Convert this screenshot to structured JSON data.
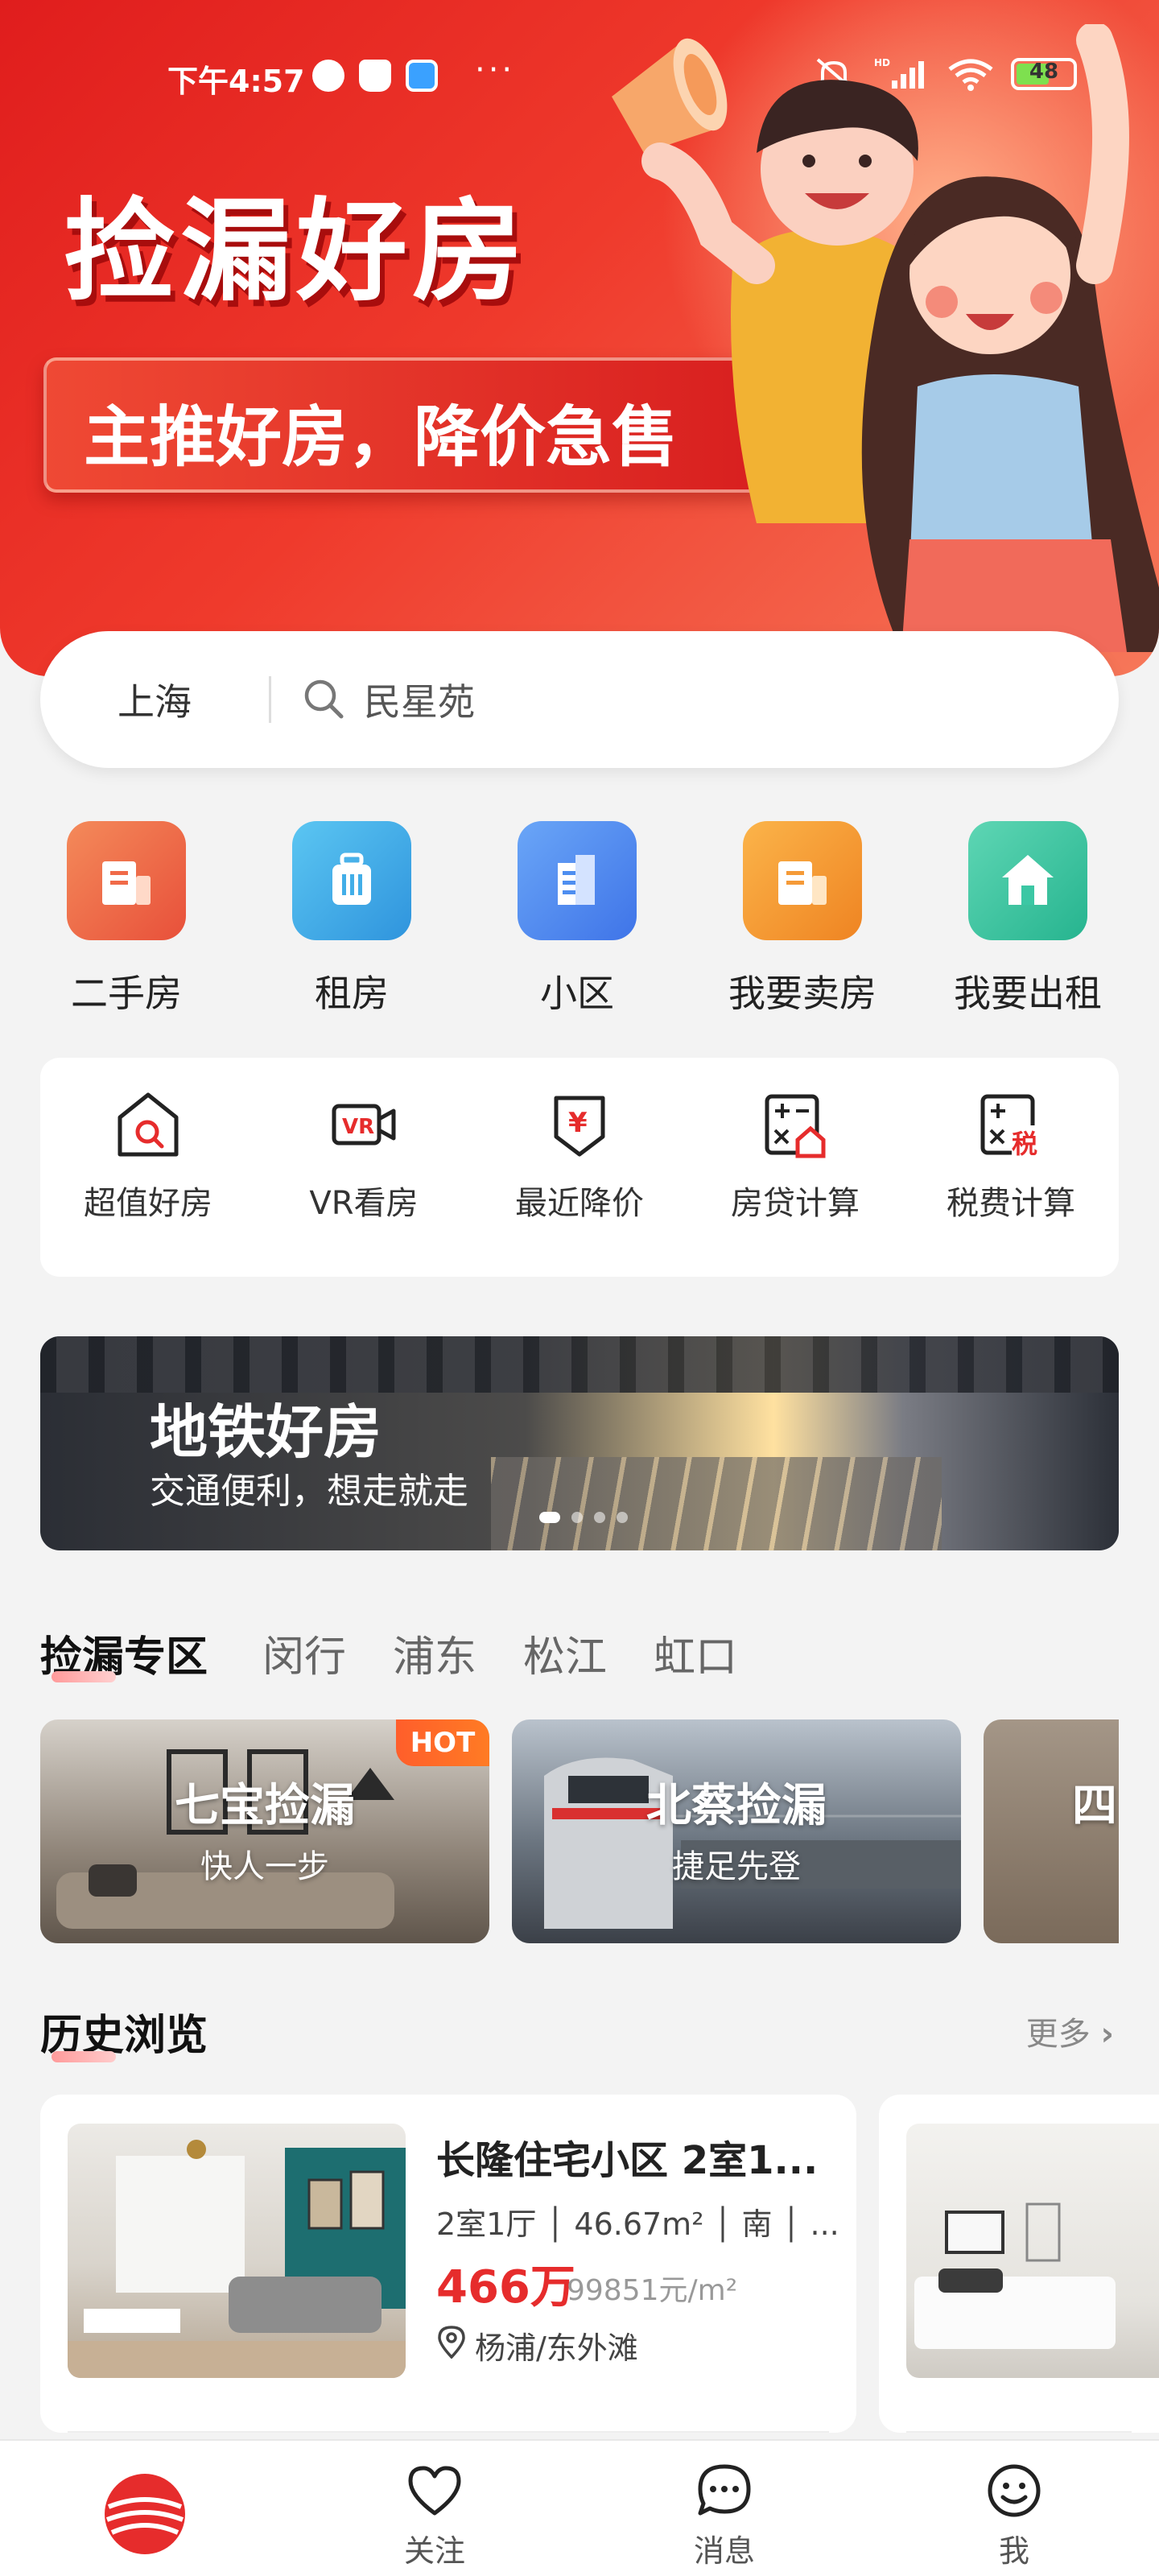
{
  "status_bar": {
    "time": "下午4:57",
    "battery": "48",
    "signal": "HD"
  },
  "hero": {
    "title": "捡漏好房",
    "subtitle": "主推好房，降价急售"
  },
  "search": {
    "city": "上海",
    "placeholder": "民星苑"
  },
  "categories": [
    {
      "label": "二手房",
      "icon": "building-icon",
      "color": "#f06a48"
    },
    {
      "label": "租房",
      "icon": "suitcase-icon",
      "color": "#42aee8"
    },
    {
      "label": "小区",
      "icon": "apartment-icon",
      "color": "#4e8ef0"
    },
    {
      "label": "我要卖房",
      "icon": "building-icon",
      "color": "#f59a37"
    },
    {
      "label": "我要出租",
      "icon": "house-icon",
      "color": "#3cc7a4"
    }
  ],
  "tools": [
    {
      "label": "超值好房",
      "icon": "house-search-icon"
    },
    {
      "label": "VR看房",
      "icon": "vr-camera-icon"
    },
    {
      "label": "最近降价",
      "icon": "price-drop-icon"
    },
    {
      "label": "房贷计算",
      "icon": "mortgage-calculator-icon"
    },
    {
      "label": "税费计算",
      "icon": "tax-calculator-icon"
    }
  ],
  "banner": {
    "title": "地铁好房",
    "subtitle": "交通便利，想走就走"
  },
  "zone": {
    "tabs": [
      "捡漏专区",
      "闵行",
      "浦东",
      "松江",
      "虹口"
    ],
    "cards": [
      {
        "title": "七宝捡漏",
        "subtitle": "快人一步",
        "badge": "HOT"
      },
      {
        "title": "北蔡捡漏",
        "subtitle": "捷足先登"
      },
      {
        "title": "四"
      }
    ]
  },
  "history": {
    "title": "历史浏览",
    "more": "更多",
    "items": [
      {
        "title": "长隆住宅小区 2室1...",
        "specs": "2室1厅 │ 46.67m² │ 南 │ ...",
        "price": "466万",
        "unit_price": "99851元/m²",
        "location": "杨浦/东外滩"
      }
    ]
  },
  "tabbar": [
    {
      "label": "",
      "icon": "logo-icon"
    },
    {
      "label": "关注",
      "icon": "heart-icon"
    },
    {
      "label": "消息",
      "icon": "message-icon"
    },
    {
      "label": "我",
      "icon": "smile-icon"
    }
  ]
}
